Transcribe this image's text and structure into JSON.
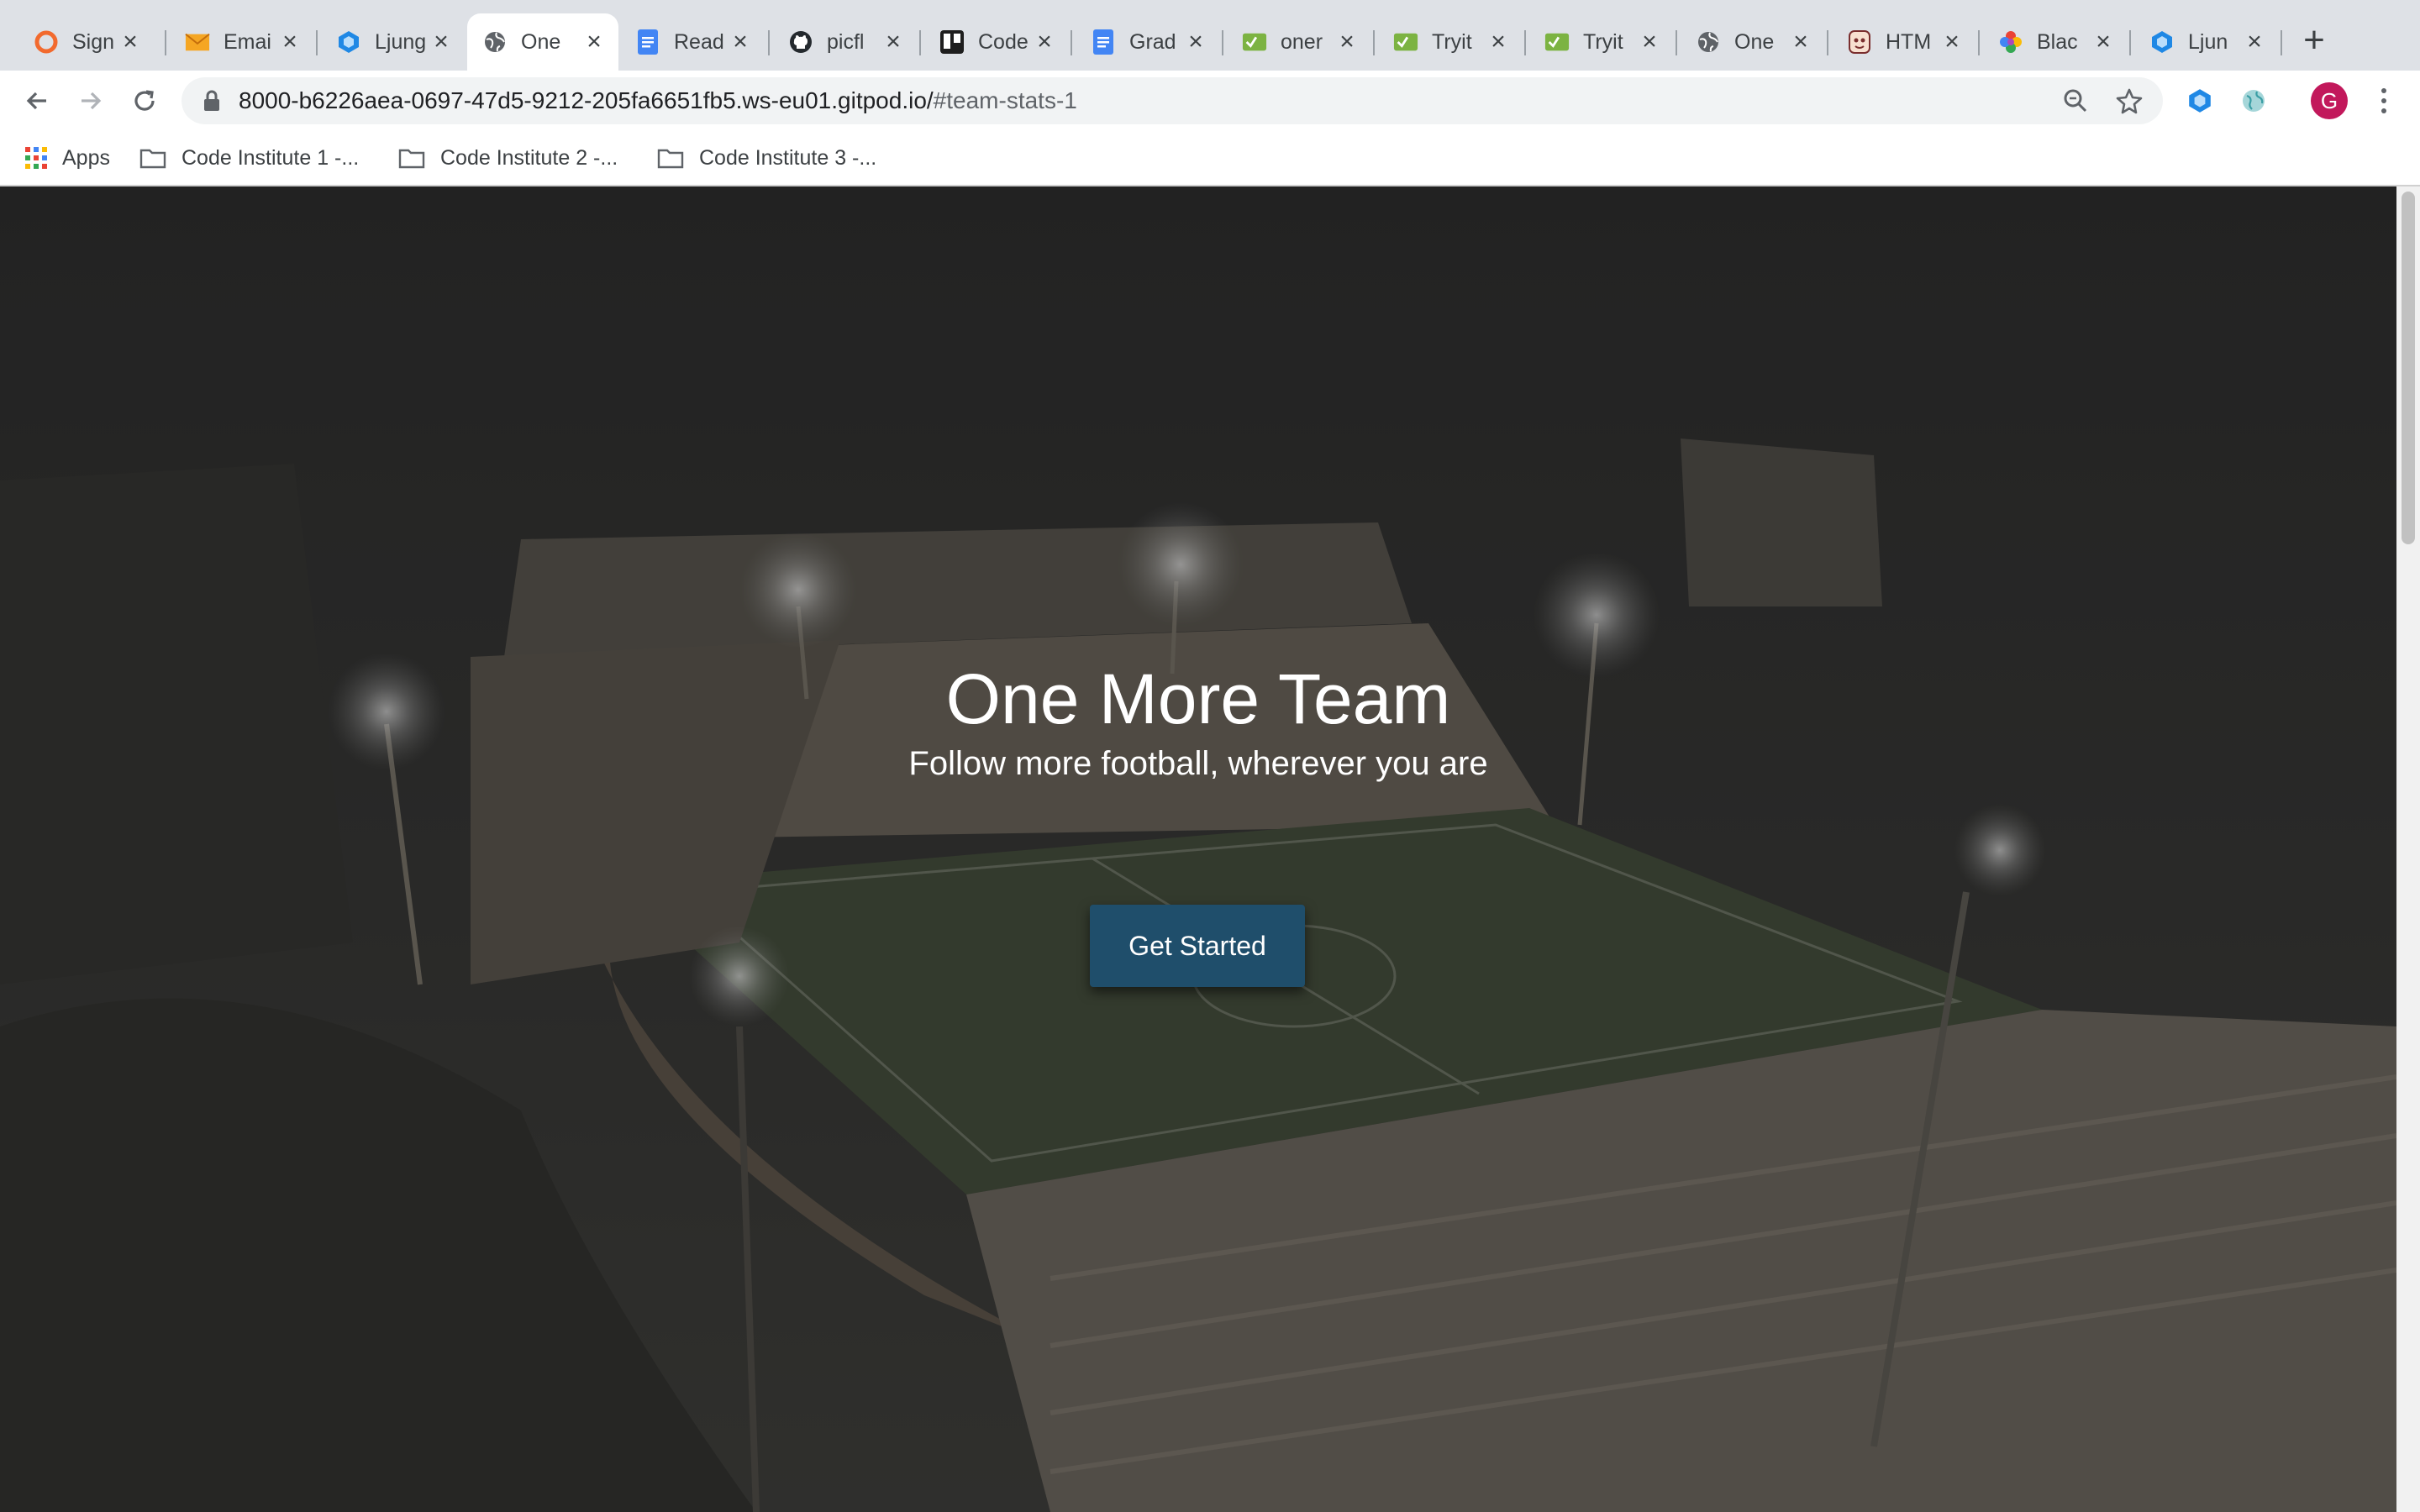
{
  "browser": {
    "tabs": [
      {
        "label": "Sign",
        "icon": "orange-circle-icon"
      },
      {
        "label": "Emai",
        "icon": "envelope-icon"
      },
      {
        "label": "Ljung",
        "icon": "hexagon-icon"
      },
      {
        "label": "One",
        "icon": "globe-icon",
        "active": true
      },
      {
        "label": "Read",
        "icon": "docs-icon"
      },
      {
        "label": "picfl",
        "icon": "github-icon"
      },
      {
        "label": "Code",
        "icon": "trello-icon"
      },
      {
        "label": "Grad",
        "icon": "docs-icon"
      },
      {
        "label": "oner",
        "icon": "w3c-validator-icon"
      },
      {
        "label": "Tryit",
        "icon": "w3c-validator-icon"
      },
      {
        "label": "Tryit",
        "icon": "w3c-validator-icon"
      },
      {
        "label": "One",
        "icon": "globe-icon"
      },
      {
        "label": "HTM",
        "icon": "character-icon"
      },
      {
        "label": "Blac",
        "icon": "pinwheel-icon"
      },
      {
        "label": "Ljun",
        "icon": "hexagon-icon"
      }
    ],
    "new_tab_label": "+",
    "url_main": "8000-b6226aea-0697-47d5-9212-205fa6651fb5.ws-eu01.gitpod.io/",
    "url_fragment": "#team-stats-1",
    "avatar_letter": "G",
    "bookmarks": [
      {
        "label": "Apps",
        "icon": "apps-grid-icon"
      },
      {
        "label": "Code Institute 1 -...",
        "icon": "folder-icon"
      },
      {
        "label": "Code Institute 2 -...",
        "icon": "folder-icon"
      },
      {
        "label": "Code Institute 3 -...",
        "icon": "folder-icon"
      }
    ]
  },
  "hero": {
    "title": "One More Team",
    "subtitle": "Follow more football, wherever you are",
    "cta_label": "Get Started"
  },
  "colors": {
    "cta_background": "#1f4e6b",
    "avatar": "#c2185b",
    "tabstrip": "#dee1e6"
  }
}
